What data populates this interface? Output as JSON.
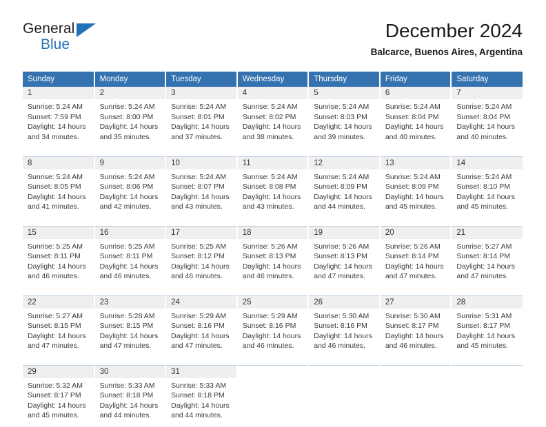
{
  "brand": {
    "name_part1": "General",
    "name_part2": "Blue",
    "triangle_color": "#2272b8",
    "text_color": "#231f20"
  },
  "header": {
    "title": "December 2024",
    "subtitle": "Balcarce, Buenos Aires, Argentina"
  },
  "colors": {
    "header_bg": "#3572b0",
    "header_text": "#ffffff",
    "daynum_bg": "#efefef",
    "row_divider": "#b8cde0",
    "body_text": "#3a3a3a"
  },
  "weekdays": [
    "Sunday",
    "Monday",
    "Tuesday",
    "Wednesday",
    "Thursday",
    "Friday",
    "Saturday"
  ],
  "weeks": [
    [
      {
        "day": "1",
        "sunrise": "Sunrise: 5:24 AM",
        "sunset": "Sunset: 7:59 PM",
        "daylight1": "Daylight: 14 hours",
        "daylight2": "and 34 minutes."
      },
      {
        "day": "2",
        "sunrise": "Sunrise: 5:24 AM",
        "sunset": "Sunset: 8:00 PM",
        "daylight1": "Daylight: 14 hours",
        "daylight2": "and 35 minutes."
      },
      {
        "day": "3",
        "sunrise": "Sunrise: 5:24 AM",
        "sunset": "Sunset: 8:01 PM",
        "daylight1": "Daylight: 14 hours",
        "daylight2": "and 37 minutes."
      },
      {
        "day": "4",
        "sunrise": "Sunrise: 5:24 AM",
        "sunset": "Sunset: 8:02 PM",
        "daylight1": "Daylight: 14 hours",
        "daylight2": "and 38 minutes."
      },
      {
        "day": "5",
        "sunrise": "Sunrise: 5:24 AM",
        "sunset": "Sunset: 8:03 PM",
        "daylight1": "Daylight: 14 hours",
        "daylight2": "and 39 minutes."
      },
      {
        "day": "6",
        "sunrise": "Sunrise: 5:24 AM",
        "sunset": "Sunset: 8:04 PM",
        "daylight1": "Daylight: 14 hours",
        "daylight2": "and 40 minutes."
      },
      {
        "day": "7",
        "sunrise": "Sunrise: 5:24 AM",
        "sunset": "Sunset: 8:04 PM",
        "daylight1": "Daylight: 14 hours",
        "daylight2": "and 40 minutes."
      }
    ],
    [
      {
        "day": "8",
        "sunrise": "Sunrise: 5:24 AM",
        "sunset": "Sunset: 8:05 PM",
        "daylight1": "Daylight: 14 hours",
        "daylight2": "and 41 minutes."
      },
      {
        "day": "9",
        "sunrise": "Sunrise: 5:24 AM",
        "sunset": "Sunset: 8:06 PM",
        "daylight1": "Daylight: 14 hours",
        "daylight2": "and 42 minutes."
      },
      {
        "day": "10",
        "sunrise": "Sunrise: 5:24 AM",
        "sunset": "Sunset: 8:07 PM",
        "daylight1": "Daylight: 14 hours",
        "daylight2": "and 43 minutes."
      },
      {
        "day": "11",
        "sunrise": "Sunrise: 5:24 AM",
        "sunset": "Sunset: 8:08 PM",
        "daylight1": "Daylight: 14 hours",
        "daylight2": "and 43 minutes."
      },
      {
        "day": "12",
        "sunrise": "Sunrise: 5:24 AM",
        "sunset": "Sunset: 8:09 PM",
        "daylight1": "Daylight: 14 hours",
        "daylight2": "and 44 minutes."
      },
      {
        "day": "13",
        "sunrise": "Sunrise: 5:24 AM",
        "sunset": "Sunset: 8:09 PM",
        "daylight1": "Daylight: 14 hours",
        "daylight2": "and 45 minutes."
      },
      {
        "day": "14",
        "sunrise": "Sunrise: 5:24 AM",
        "sunset": "Sunset: 8:10 PM",
        "daylight1": "Daylight: 14 hours",
        "daylight2": "and 45 minutes."
      }
    ],
    [
      {
        "day": "15",
        "sunrise": "Sunrise: 5:25 AM",
        "sunset": "Sunset: 8:11 PM",
        "daylight1": "Daylight: 14 hours",
        "daylight2": "and 46 minutes."
      },
      {
        "day": "16",
        "sunrise": "Sunrise: 5:25 AM",
        "sunset": "Sunset: 8:11 PM",
        "daylight1": "Daylight: 14 hours",
        "daylight2": "and 46 minutes."
      },
      {
        "day": "17",
        "sunrise": "Sunrise: 5:25 AM",
        "sunset": "Sunset: 8:12 PM",
        "daylight1": "Daylight: 14 hours",
        "daylight2": "and 46 minutes."
      },
      {
        "day": "18",
        "sunrise": "Sunrise: 5:26 AM",
        "sunset": "Sunset: 8:13 PM",
        "daylight1": "Daylight: 14 hours",
        "daylight2": "and 46 minutes."
      },
      {
        "day": "19",
        "sunrise": "Sunrise: 5:26 AM",
        "sunset": "Sunset: 8:13 PM",
        "daylight1": "Daylight: 14 hours",
        "daylight2": "and 47 minutes."
      },
      {
        "day": "20",
        "sunrise": "Sunrise: 5:26 AM",
        "sunset": "Sunset: 8:14 PM",
        "daylight1": "Daylight: 14 hours",
        "daylight2": "and 47 minutes."
      },
      {
        "day": "21",
        "sunrise": "Sunrise: 5:27 AM",
        "sunset": "Sunset: 8:14 PM",
        "daylight1": "Daylight: 14 hours",
        "daylight2": "and 47 minutes."
      }
    ],
    [
      {
        "day": "22",
        "sunrise": "Sunrise: 5:27 AM",
        "sunset": "Sunset: 8:15 PM",
        "daylight1": "Daylight: 14 hours",
        "daylight2": "and 47 minutes."
      },
      {
        "day": "23",
        "sunrise": "Sunrise: 5:28 AM",
        "sunset": "Sunset: 8:15 PM",
        "daylight1": "Daylight: 14 hours",
        "daylight2": "and 47 minutes."
      },
      {
        "day": "24",
        "sunrise": "Sunrise: 5:29 AM",
        "sunset": "Sunset: 8:16 PM",
        "daylight1": "Daylight: 14 hours",
        "daylight2": "and 47 minutes."
      },
      {
        "day": "25",
        "sunrise": "Sunrise: 5:29 AM",
        "sunset": "Sunset: 8:16 PM",
        "daylight1": "Daylight: 14 hours",
        "daylight2": "and 46 minutes."
      },
      {
        "day": "26",
        "sunrise": "Sunrise: 5:30 AM",
        "sunset": "Sunset: 8:16 PM",
        "daylight1": "Daylight: 14 hours",
        "daylight2": "and 46 minutes."
      },
      {
        "day": "27",
        "sunrise": "Sunrise: 5:30 AM",
        "sunset": "Sunset: 8:17 PM",
        "daylight1": "Daylight: 14 hours",
        "daylight2": "and 46 minutes."
      },
      {
        "day": "28",
        "sunrise": "Sunrise: 5:31 AM",
        "sunset": "Sunset: 8:17 PM",
        "daylight1": "Daylight: 14 hours",
        "daylight2": "and 45 minutes."
      }
    ],
    [
      {
        "day": "29",
        "sunrise": "Sunrise: 5:32 AM",
        "sunset": "Sunset: 8:17 PM",
        "daylight1": "Daylight: 14 hours",
        "daylight2": "and 45 minutes."
      },
      {
        "day": "30",
        "sunrise": "Sunrise: 5:33 AM",
        "sunset": "Sunset: 8:18 PM",
        "daylight1": "Daylight: 14 hours",
        "daylight2": "and 44 minutes."
      },
      {
        "day": "31",
        "sunrise": "Sunrise: 5:33 AM",
        "sunset": "Sunset: 8:18 PM",
        "daylight1": "Daylight: 14 hours",
        "daylight2": "and 44 minutes."
      },
      {
        "day": "",
        "sunrise": "",
        "sunset": "",
        "daylight1": "",
        "daylight2": ""
      },
      {
        "day": "",
        "sunrise": "",
        "sunset": "",
        "daylight1": "",
        "daylight2": ""
      },
      {
        "day": "",
        "sunrise": "",
        "sunset": "",
        "daylight1": "",
        "daylight2": ""
      },
      {
        "day": "",
        "sunrise": "",
        "sunset": "",
        "daylight1": "",
        "daylight2": ""
      }
    ]
  ]
}
